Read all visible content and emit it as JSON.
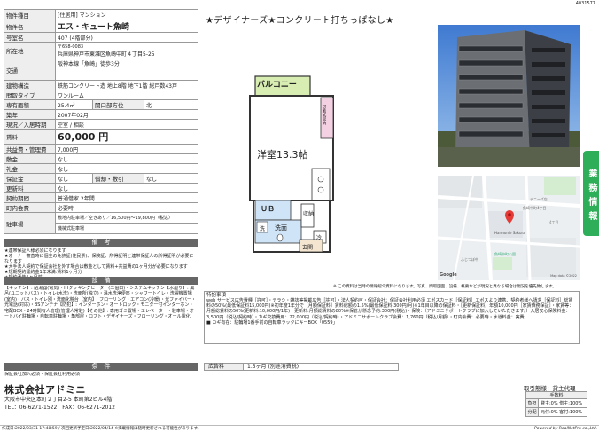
{
  "ref_code": "4031577",
  "headline": "★デザイナーズ★コンクリート打ちっぱなし★",
  "spec": {
    "type_label": "物件種目",
    "type_value": "[住居用] マンション",
    "name_label": "物件名",
    "name_value": "エス・キュート魚崎",
    "room_label": "号室名",
    "room_value": "407 (4階部分)",
    "address_label": "所在地",
    "postal": "〒658-0083",
    "address": "兵庫県神戸市東灘区魚崎中町４丁目5-25",
    "access_label": "交通",
    "access": "阪神本線「魚崎」徒歩3分",
    "structure_label": "建物構造",
    "structure": "鉄筋コンクリート造 地上8階 地下1階 総戸数43戸",
    "layout_label": "間取タイプ",
    "layout": "ワンルーム",
    "area_label": "専有面積",
    "area": "25.4㎡",
    "direction_label": "開口部方位",
    "direction": "北",
    "built_label": "築年",
    "built": "2007年02月",
    "status_label": "現況／入居時期",
    "status": "空室 / 相談",
    "rent_label": "賃料",
    "rent": "60,000 円",
    "mgmt_label": "共益費・管理費",
    "mgmt": "7,000円",
    "deposit_label": "敷金",
    "deposit": "なし",
    "key_label": "礼金",
    "key": "なし",
    "guarantee_label": "保証金",
    "guarantee": "なし",
    "amort_label": "償却・敷引",
    "amort": "なし",
    "renewal_label": "更新料",
    "renewal": "なし",
    "contract_label": "契約期間",
    "contract": "普通借家 2年間",
    "insurance_label": "町内会費",
    "insurance": "必要時",
    "parking_label": "駐車場",
    "parking1": "敷地内駐車場／空きあり／16,500円～19,800円（税込）",
    "parking2": "機械式駐車場"
  },
  "notes_title": "備　考",
  "notes": [
    "★連帯保証人様必須になります",
    "★オーナー審査時に個主の免許証(住民票)、保険証、所得証明と連帯保証人の所得証明が必要になります",
    "★大手法人契約で保証会社を外す場合は敷金として賃料+共益費の1ヶ月分が必要になります",
    "★短期契約違約金1年未満:賃料1ヶ月分",
    "★契約予告1ヶ月前",
    "★決済時、預かり賃料は、当月・次月分が必要になります"
  ],
  "equip_title": "設　備",
  "equip": "【キッチン】: 給湯器(電気)・IHクッキングヒーター(二個口)・システムキッチン【水廻り】: 風呂(ユニットバス)・トイレ(水洗)・洗面所(独立)・温水洗浄便座・シャワートイレ・洗濯機置場(室内)・バス・トイレ別・洗面化粧台【室内】: フローリング・エアコン(冷暖)・光ファイバー・光電話(対応)・BSアンテナ【防犯】: インターホン・オートロック・モニター付インターホン・宅配BOX・24時間有人管理(管理人常駐)【その他】: 専用ゴミ置場・エレベーター・駐車場・オートバイ駐輪場・自転車駐輪場・角部屋・ロフト・デザイナーズ・フローリング・オール電化",
  "terms_title": "条　件",
  "terms": "保証会社加入必須・保証会社利用必須",
  "company": {
    "name": "株式会社アドミニ",
    "address": "大阪市中央区本町２丁目2-5 本町第2ビル4階",
    "tel": "TEL：06-6271-1522　FAX：06-6271-2012"
  },
  "floorplan": {
    "balcony": "バルコニー",
    "room": "洋室13.3帖",
    "ub": "ＵＢ",
    "washroom": "洗面",
    "entrance": "玄関",
    "closet": "収納",
    "storage": "可動式収納",
    "fridge": "冷",
    "wash": "洗"
  },
  "floorplan_note": "※ この資料は当時の情報紹介資料になります。写真、間取図面、設備、概要などが現況と異なる場合は現況を優先致します。",
  "features_label": "特記事項",
  "features": "web サービス広告費種［許可］・テラシ・雑誌等掲載広告［許可］・法人契約可・保証会社：保証会社利用必須 エポスカード［保証料］エポスより連携、契約者様へ請求［保証料］総賃料の50%(最低保証料15,000円)※初年度1年分で［月額保証料］賃料総額の1.5%(最低保証料 300円/月)※1年目以降の保証料・［更新保証料］年額10,000円［家賃債務保証］・家賃等：月額総賃料の50%(更新料:10,000円/1年)・更新料:月額総賃料の80%※保管が懸念予約:300円(税込)・保険：（アドミニサポートクラブに加入していただきます。）入居安心保険料金：3,500円（税込/契約時）・カギ交換費用：22,000円（税込/契約時）・アドミニサポートクラブ会費：1,760円（税込/月額）・町内会費：必要時・水道料金：実費",
  "features_extra": "■ カギ有在：駐輪場1番手前の自転車ラックにキーBOX「0559」",
  "ad_label": "広告料",
  "ad_value": "1.5ヶ月 (別途消費税)",
  "badge": "業務情報",
  "broker": {
    "title": "取引態様：貸主代理",
    "fee_header": "手数料",
    "row1_label": "負担",
    "row1": "貸主:0% 借主:100%",
    "row2_label": "分配",
    "row2": "元付:0% 客付:100%"
  },
  "map": {
    "labels": [
      "デニーズ店",
      "魚崎中町4丁目",
      "4丁目",
      "Harmonie Sakura",
      "魚崎中町公園",
      "ふじつぼ中",
      "Google",
      "Map data ©2022"
    ]
  },
  "footer": {
    "left": "作成日:2022/03/31 17:48:59 / 次回更新予定日:2022/04/14 ※掲載情報は随時更新される可能性があります。",
    "right": "Powered by RealNetPro co.,Ltd."
  }
}
